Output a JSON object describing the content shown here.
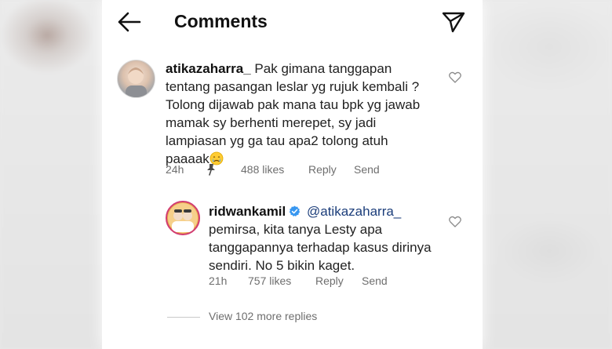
{
  "header": {
    "title": "Comments"
  },
  "comments": [
    {
      "username": "atikazaharra_",
      "text": "Pak gimana tanggapan tentang pasangan leslar yg rujuk kembali ? Tolong dijawab pak mana tau bpk yg jawab mamak sy berhenti merepet, sy jadi lampiasan yg ga tau apa2 tolong atuh paaaak",
      "emoji": "crying-face",
      "time": "24h",
      "pinned_icon": "pin-icon",
      "likes": "488 likes",
      "reply_label": "Reply",
      "send_label": "Send"
    }
  ],
  "reply": {
    "username": "ridwankamil",
    "verified": true,
    "mention": "@atikazaharra_",
    "text": "pemirsa, kita tanya Lesty apa tanggapannya terhadap kasus dirinya sendiri. No 5 bikin kaget.",
    "time": "21h",
    "likes": "757 likes",
    "reply_label": "Reply",
    "send_label": "Send"
  },
  "view_more": "View 102 more replies",
  "colors": {
    "text": "#222222",
    "meta": "#6e6e6e",
    "verified": "#3897f0",
    "mention": "#1b3d7a"
  }
}
